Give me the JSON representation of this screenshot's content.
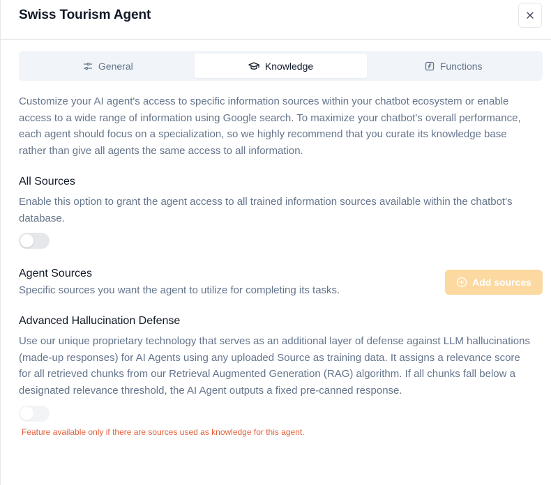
{
  "modal": {
    "title": "Swiss Tourism Agent",
    "close_icon": "close-icon"
  },
  "tabs": [
    {
      "label": "General",
      "icon": "sliders-icon",
      "active": false
    },
    {
      "label": "Knowledge",
      "icon": "graduation-cap-icon",
      "active": true
    },
    {
      "label": "Functions",
      "icon": "function-icon",
      "active": false
    }
  ],
  "intro": "Customize your AI agent's access to specific information sources within your chatbot ecosystem or enable access to a wide range of information using Google search. To maximize your chatbot's overall performance, each agent should focus on a specialization, so we highly recommend that you curate its knowledge base rather than give all agents the same access to all information.",
  "all_sources": {
    "title": "All Sources",
    "description": "Enable this option to grant the agent access to all trained information sources available within the chatbot's database.",
    "enabled": false
  },
  "agent_sources": {
    "title": "Agent Sources",
    "description": "Specific sources you want the agent to utilize for completing its tasks.",
    "add_button": "Add sources",
    "add_icon": "plus-circle-icon"
  },
  "hallucination": {
    "title": "Advanced Hallucination Defense",
    "description": "Use our unique proprietary technology that serves as an additional layer of defense against LLM hallucinations (made-up responses) for AI Agents using any uploaded Source as training data. It assigns a relevance score for all retrieved chunks from our Retrieval Augmented Generation (RAG) algorithm. If all chunks fall below a designated relevance threshold, the AI Agent outputs a fixed pre-canned response.",
    "enabled": false,
    "note": "Feature available only if there are sources used as knowledge for this agent."
  },
  "colors": {
    "accent_button": "#fcd9a0",
    "warning_text": "#e0603a"
  }
}
